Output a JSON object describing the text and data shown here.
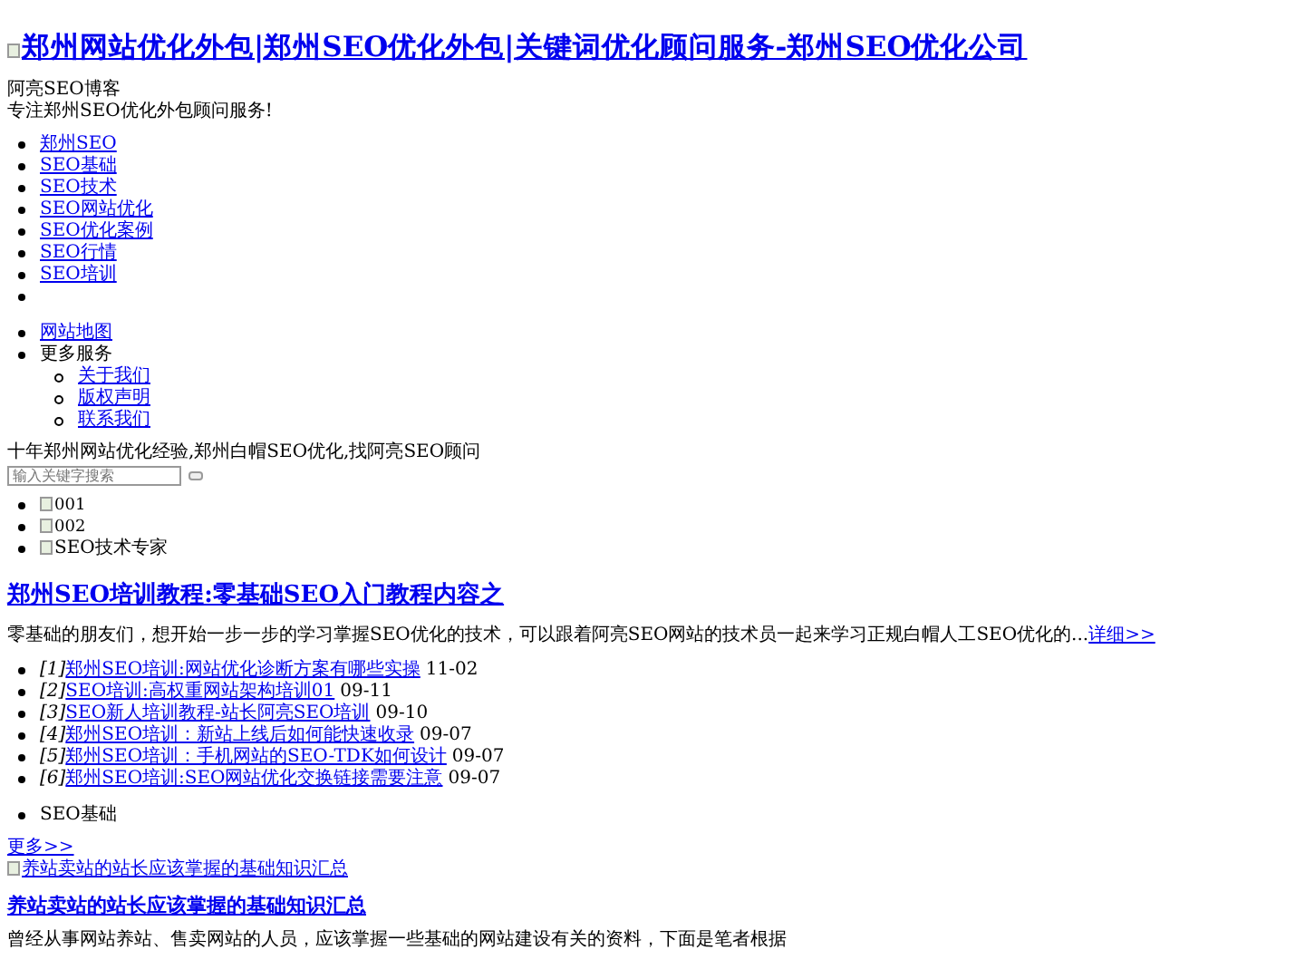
{
  "header": {
    "logo_alt": "郑州网站优化外包|郑州SEO优化外包|关键词优化顾问服务-郑州SEO优化公司",
    "site_name": "阿亮SEO博客",
    "tagline": "专注郑州SEO优化外包顾问服务!"
  },
  "nav": [
    "郑州SEO",
    "SEO基础",
    "SEO技术",
    "SEO网站优化",
    "SEO优化案例",
    "SEO行情",
    "SEO培训"
  ],
  "nav_trailing_empty_item": true,
  "nav2": {
    "sitemap": "网站地图",
    "more": "更多服务",
    "sub": [
      "关于我们",
      "版权声明",
      "联系我们"
    ]
  },
  "slogan": "十年郑州网站优化经验,郑州白帽SEO优化,找阿亮SEO顾问",
  "search": {
    "placeholder": "输入关键字搜索"
  },
  "slides": [
    {
      "alt": "001",
      "kind": "small"
    },
    {
      "alt": "002",
      "kind": "small"
    },
    {
      "alt": "SEO技术专家",
      "kind": "large"
    }
  ],
  "featured": {
    "title": "郑州SEO培训教程:零基础SEO入门教程内容之",
    "summary": "零基础的朋友们，想开始一步一步的学习掌握SEO优化的技术，可以跟着阿亮SEO网站的技术员一起来学习正规白帽人工SEO优化的...",
    "more": "详细>>"
  },
  "articles": [
    {
      "index": "[1]",
      "title": "郑州SEO培训:网站优化诊断方案有哪些实操",
      "date": "11-02"
    },
    {
      "index": "[2]",
      "title": "SEO培训:高权重网站架构培训01",
      "date": "09-11"
    },
    {
      "index": "[3]",
      "title": "SEO新人培训教程-站长阿亮SEO培训",
      "date": "09-10"
    },
    {
      "index": "[4]",
      "title": "郑州SEO培训：新站上线后如何能快速收录",
      "date": "09-07"
    },
    {
      "index": "[5]",
      "title": "郑州SEO培训：手机网站的SEO-TDK如何设计",
      "date": "09-07"
    },
    {
      "index": "[6]",
      "title": "郑州SEO培训:SEO网站优化交换链接需要注意",
      "date": "09-07"
    }
  ],
  "section": {
    "title": "SEO基础",
    "more": "更多>>",
    "image_alt": "养站卖站的站长应该掌握的基础知识汇总",
    "post_title": "养站卖站的站长应该掌握的基础知识汇总",
    "post_summary": "曾经从事网站养站、售卖网站的人员，应该掌握一些基础的网站建设有关的资料，下面是笔者根据"
  }
}
